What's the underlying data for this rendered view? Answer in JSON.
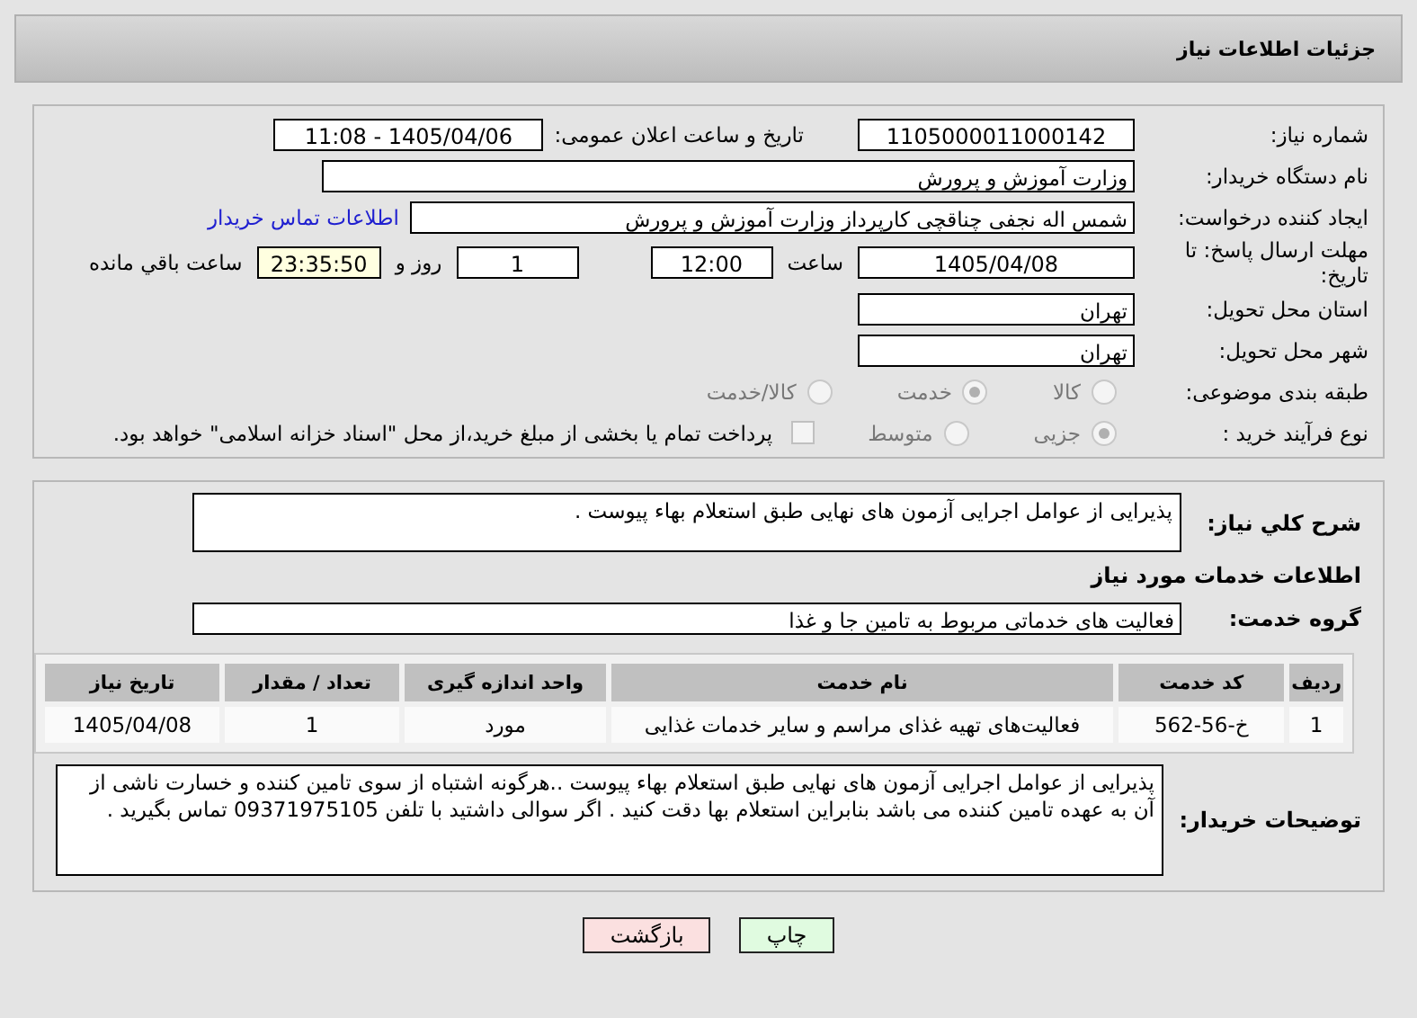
{
  "header": {
    "title": "جزئیات اطلاعات نیاز"
  },
  "details": {
    "need_number": {
      "label": "شماره نیاز:",
      "value": "1105000011000142"
    },
    "announce": {
      "label": "تاریخ و ساعت اعلان عمومی:",
      "value": "1405/04/06 - 11:08"
    },
    "buyer": {
      "label": "نام دستگاه خریدار:",
      "value": "وزارت آموزش و پرورش"
    },
    "creator": {
      "label": "ایجاد کننده درخواست:",
      "value": "شمس اله نجفی چناقچی کارپرداز وزارت آموزش و پرورش",
      "link": "اطلاعات تماس خریدار"
    },
    "deadline": {
      "label": "مهلت ارسال پاسخ: تا تاریخ:",
      "date": "1405/04/08",
      "time_label": "ساعت",
      "time": "12:00",
      "days": "1",
      "days_label": "روز و",
      "remaining": "23:35:50",
      "remaining_label": "ساعت باقي مانده"
    },
    "province": {
      "label": "استان محل تحویل:",
      "value": "تهران"
    },
    "city": {
      "label": "شهر محل تحویل:",
      "value": "تهران"
    },
    "category": {
      "label": "طبقه بندی موضوعی:",
      "options": [
        {
          "label": "کالا",
          "selected": false
        },
        {
          "label": "خدمت",
          "selected": true
        },
        {
          "label": "کالا/خدمت",
          "selected": false
        }
      ]
    },
    "process": {
      "label": "نوع فرآیند خرید :",
      "options": [
        {
          "label": "جزیی",
          "selected": true
        },
        {
          "label": "متوسط",
          "selected": false
        }
      ],
      "treasury": {
        "label": "پرداخت تمام یا بخشی از مبلغ خرید،از محل \"اسناد خزانه اسلامی\" خواهد بود.",
        "checked": false
      }
    }
  },
  "services": {
    "summary": {
      "label": "شرح کلي نیاز:",
      "value": "پذیرایی از عوامل اجرایی آزمون های نهایی طبق استعلام بهاء پیوست ."
    },
    "section_title": "اطلاعات خدمات مورد نیاز",
    "group": {
      "label": "گروه خدمت:",
      "value": "فعالیت های خدماتی مربوط به تامین جا و غذا"
    },
    "table": {
      "columns": [
        "ردیف",
        "کد خدمت",
        "نام خدمت",
        "واحد اندازه گیری",
        "تعداد / مقدار",
        "تاریخ نیاز"
      ],
      "rows": [
        [
          "1",
          "خ-56-562",
          "فعالیت‌های تهیه غذای مراسم و سایر خدمات غذایی",
          "مورد",
          "1",
          "1405/04/08"
        ]
      ]
    },
    "notes": {
      "label": "توضیحات خریدار:",
      "value": "پذیرایی از عوامل اجرایی آزمون های نهایی طبق استعلام بهاء پیوست ..هرگونه اشتباه از سوی تامین کننده و خسارت ناشی از آن به عهده تامین کننده می باشد بنابراین استعلام بها دقت کنید . اگر سوالی داشتید با تلفن 09371975105 تماس بگیرید ."
    }
  },
  "buttons": [
    {
      "label": "چاپ",
      "kind": "print"
    },
    {
      "label": "بازگشت",
      "kind": "back"
    }
  ]
}
